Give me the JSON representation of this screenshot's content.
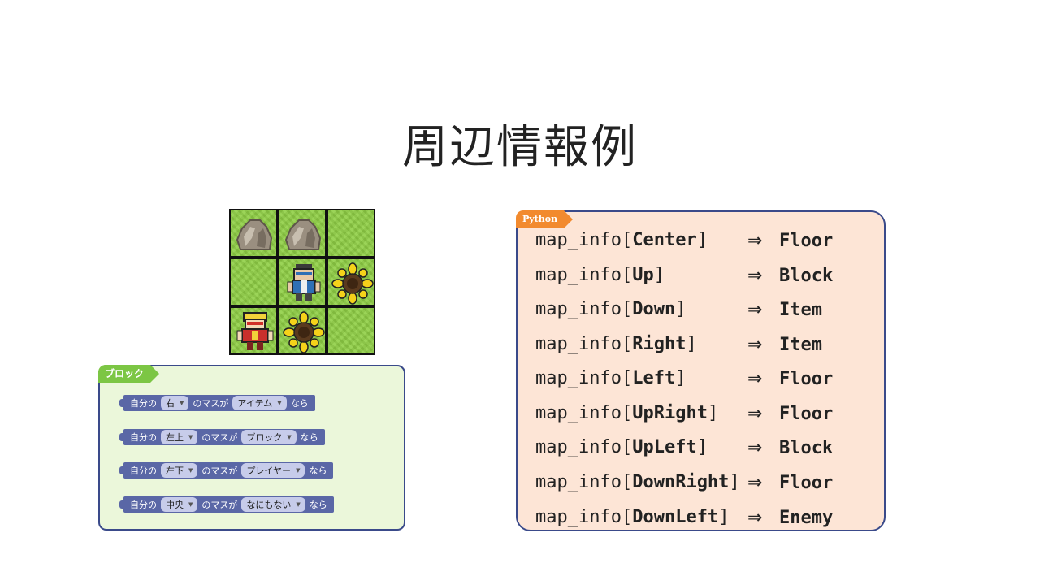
{
  "title": "周辺情報例",
  "map": {
    "cells": [
      {
        "content": "rock-icon"
      },
      {
        "content": "rock-icon"
      },
      {
        "content": "floor"
      },
      {
        "content": "floor"
      },
      {
        "content": "player-icon"
      },
      {
        "content": "sunflower-icon"
      },
      {
        "content": "enemy-icon"
      },
      {
        "content": "sunflower-icon"
      },
      {
        "content": "floor"
      }
    ]
  },
  "block_panel": {
    "tag": "ブロック",
    "rows": [
      {
        "prefix": "自分の",
        "dir": "右",
        "mid": "のマスが",
        "kind": "アイテム",
        "suffix": "なら"
      },
      {
        "prefix": "自分の",
        "dir": "左上",
        "mid": "のマスが",
        "kind": "ブロック",
        "suffix": "なら"
      },
      {
        "prefix": "自分の",
        "dir": "左下",
        "mid": "のマスが",
        "kind": "プレイヤー",
        "suffix": "なら"
      },
      {
        "prefix": "自分の",
        "dir": "中央",
        "mid": "のマスが",
        "kind": "なにもない",
        "suffix": "なら"
      }
    ]
  },
  "python_panel": {
    "tag": "Python",
    "arrow": "⇒",
    "rows": [
      {
        "prefix": "map_info[",
        "key": "Center",
        "suffix": "]",
        "value": "Floor"
      },
      {
        "prefix": "map_info[",
        "key": "Up",
        "suffix": "]",
        "value": "Block"
      },
      {
        "prefix": "map_info[",
        "key": "Down",
        "suffix": "]",
        "value": "Item"
      },
      {
        "prefix": "map_info[",
        "key": "Right",
        "suffix": "]",
        "value": "Item"
      },
      {
        "prefix": "map_info[",
        "key": "Left",
        "suffix": "]",
        "value": "Floor"
      },
      {
        "prefix": "map_info[",
        "key": "UpRight",
        "suffix": "]",
        "value": "Floor"
      },
      {
        "prefix": "map_info[",
        "key": "UpLeft",
        "suffix": "]",
        "value": "Block"
      },
      {
        "prefix": "map_info[",
        "key": "DownRight",
        "suffix": "]",
        "value": "Floor"
      },
      {
        "prefix": "map_info[",
        "key": "DownLeft",
        "suffix": "]",
        "value": "Enemy"
      }
    ]
  },
  "colors": {
    "block_tag": "#7cc644",
    "python_tag": "#f28a2e",
    "panel_border": "#3a4a8a"
  }
}
